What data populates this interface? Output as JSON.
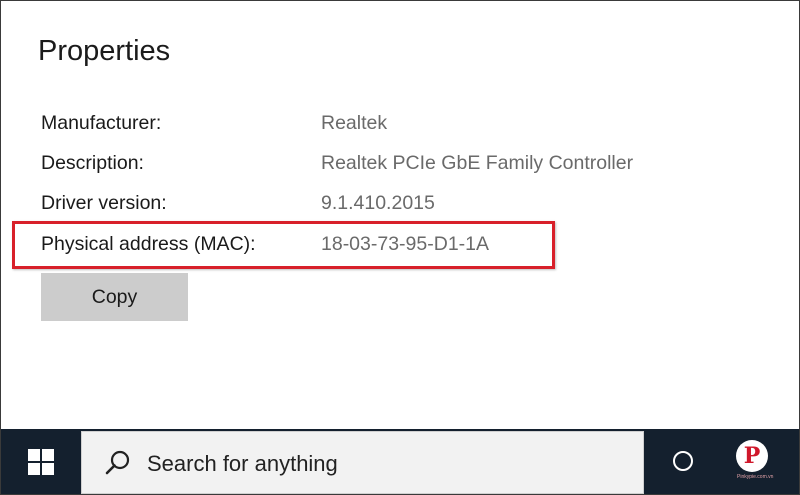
{
  "window": {
    "title": "Properties"
  },
  "properties": [
    {
      "label": "Manufacturer:",
      "value": "Realtek"
    },
    {
      "label": "Description:",
      "value": "Realtek PCIe GbE Family Controller"
    },
    {
      "label": "Driver version:",
      "value": "9.1.410.2015"
    },
    {
      "label": "Physical address (MAC):",
      "value": "18-03-73-95-D1-1A"
    }
  ],
  "copy_button": {
    "label": "Copy"
  },
  "highlight": {
    "color": "#d8202a"
  },
  "taskbar": {
    "background": "#14202e",
    "start_icon": "windows-logo-icon",
    "search_icon": "search-icon",
    "search_placeholder": "Search for anything",
    "cortana_icon": "cortana-circle-icon",
    "watermark_logo": "P",
    "watermark_caption": "Pinkypie.com.vn"
  }
}
